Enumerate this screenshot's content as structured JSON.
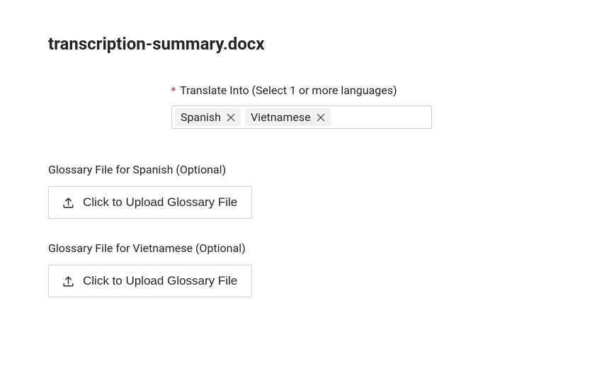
{
  "title": "transcription-summary.docx",
  "translateField": {
    "required": "*",
    "label": "Translate Into (Select 1 or more languages)",
    "selected": [
      {
        "name": "Spanish"
      },
      {
        "name": "Vietnamese"
      }
    ]
  },
  "glossarySections": [
    {
      "label": "Glossary File for Spanish (Optional)",
      "buttonLabel": "Click to Upload Glossary File"
    },
    {
      "label": "Glossary File for Vietnamese (Optional)",
      "buttonLabel": "Click to Upload Glossary File"
    }
  ]
}
